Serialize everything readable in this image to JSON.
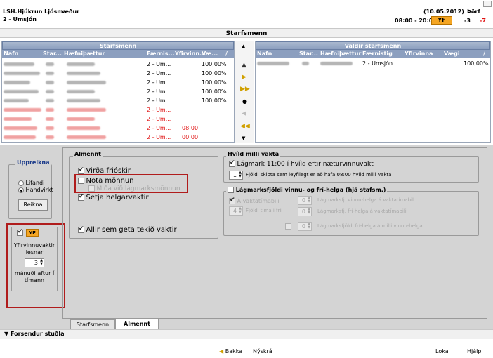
{
  "header": {
    "org": "LSH.Hjúkrun Ljósmæður",
    "unit": "2 - Umsjón",
    "date": "(10.05.2012)",
    "time_range": "08:00 - 20:00",
    "yf": "YF",
    "thorf_label": "Þörf",
    "thorf_val1": "-3",
    "thorf_val2": "-7"
  },
  "section_title": "Starfsmenn",
  "left_grid": {
    "title": "Starfsmenn",
    "columns": [
      "Nafn",
      "Star...",
      "Hæfniþættur",
      "Færnis...",
      "Yfirvinn...",
      "Væ...",
      "/"
    ],
    "rows": [
      {
        "faerni": "2 - Um...",
        "yfirvinna": "",
        "vaegi": "100,00%",
        "red": false
      },
      {
        "faerni": "2 - Um...",
        "yfirvinna": "",
        "vaegi": "100,00%",
        "red": false
      },
      {
        "faerni": "2 - Um...",
        "yfirvinna": "",
        "vaegi": "100,00%",
        "red": false
      },
      {
        "faerni": "2 - Um...",
        "yfirvinna": "",
        "vaegi": "100,00%",
        "red": false
      },
      {
        "faerni": "2 - Um...",
        "yfirvinna": "",
        "vaegi": "100,00%",
        "red": false
      },
      {
        "faerni": "2 - Um...",
        "yfirvinna": "",
        "vaegi": "",
        "red": true
      },
      {
        "faerni": "2 - Um...",
        "yfirvinna": "",
        "vaegi": "",
        "red": true
      },
      {
        "faerni": "2 - Um...",
        "yfirvinna": "08:00",
        "vaegi": "",
        "red": true
      },
      {
        "faerni": "2 - Um...",
        "yfirvinna": "00:00",
        "vaegi": "",
        "red": true
      }
    ]
  },
  "right_grid": {
    "title": "Valdir starfsmenn",
    "columns": [
      "Nafn",
      "Star...",
      "Hæfniþættur",
      "Færnistig",
      "Yfirvinna",
      "Vægi",
      "/"
    ],
    "rows": [
      {
        "faerni": "2 - Umsjón",
        "vaegi": "100,00%"
      }
    ]
  },
  "uppreikna": {
    "title": "Uppreikna",
    "lifandi": "Lifandi",
    "handvirkt": "Handvirkt",
    "reikna": "Reikna"
  },
  "yf_box": {
    "badge": "YF",
    "text1": "Yfirvinnuvaktir",
    "text2": "lesnar",
    "value": "3",
    "text3": "mánuði aftur í",
    "text4": "tímann"
  },
  "almennt": {
    "title": "Almennt",
    "vira_frioskir": "Virða frióskir",
    "nota_monnun": "Nota mönnun",
    "mida_vid": "Miða við lágmarksmönnun",
    "setja_helgar": "Setja helgarvaktir",
    "allir": "Allir sem geta tekið vaktir"
  },
  "hvild": {
    "title": "Hvíld milli vakta",
    "lagmark": "Lágmark 11:00 í hvíld eftir næturvinnuvakt",
    "value": "1",
    "fjoldi": "Fjöldi skipta sem leyfilegt er að hafa 08:00 hvíld milli vakta"
  },
  "lagmarks": {
    "title": "Lágmarksfjöldi vinnu- og frí-helga (hjá stafsm.)",
    "a_vakt": "Á vaktatímabili",
    "fjoldi_tima": "Fjöldi tíma í fríi",
    "spin_a": "4",
    "spin_b": "0",
    "spin_c": "0",
    "spin_d": "0",
    "lm1": "Lágmarksfj. vinnu-helga á vaktatímabil",
    "lm2": "Lágmarksfj. frí-helga á vaktatímabili",
    "lm3": "Lágmarksfjöldi frí-helga á milli vinnu-helga"
  },
  "tabs": [
    "Starfsmenn",
    "Almennt"
  ],
  "forsendur": "Forsendur stuðla",
  "footer": {
    "back": "Bakka",
    "new": "Nýskrá",
    "close": "Loka",
    "help": "Hjálp"
  }
}
